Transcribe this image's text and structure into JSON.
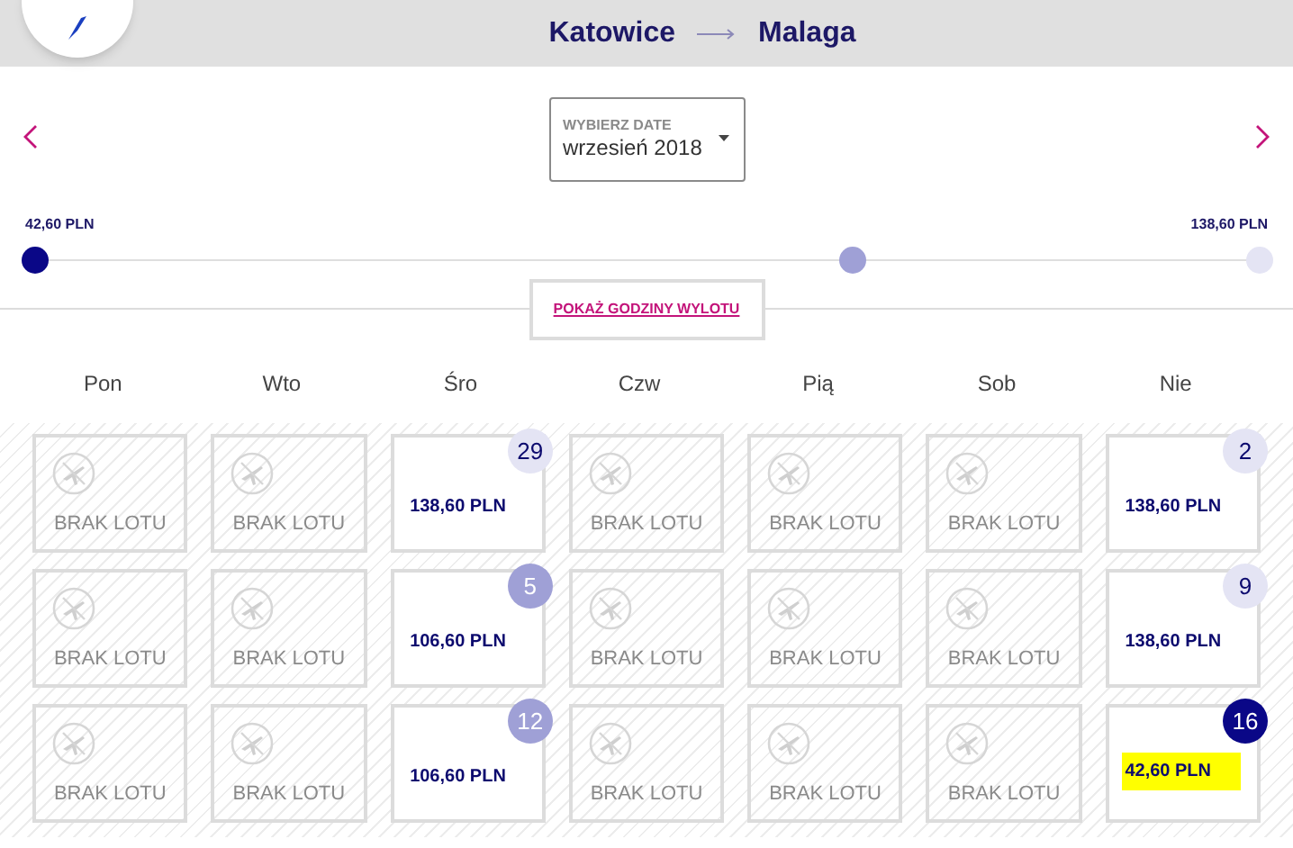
{
  "route": {
    "origin": "Katowice",
    "destination": "Malaga"
  },
  "date_picker": {
    "label": "WYBIERZ DATE",
    "value": "wrzesień 2018"
  },
  "price_scale": {
    "min_label": "42,60 PLN",
    "max_label": "138,60 PLN",
    "stops": [
      {
        "color": "#0a0787"
      },
      {
        "color": "#9fa0d6"
      },
      {
        "color": "#e4e4f4"
      }
    ]
  },
  "show_times_link": "POKAŻ GODZINY WYLOTU",
  "weekdays": [
    "Pon",
    "Wto",
    "Śro",
    "Czw",
    "Pią",
    "Sob",
    "Nie"
  ],
  "weeks": [
    [
      {
        "kind": "empty",
        "label": "BRAK LOTU"
      },
      {
        "kind": "empty",
        "label": "BRAK LOTU"
      },
      {
        "kind": "flight",
        "day": "29",
        "price": "138,60 PLN",
        "color": "#e4e4f4",
        "highlighted": false
      },
      {
        "kind": "empty",
        "label": "BRAK LOTU"
      },
      {
        "kind": "empty",
        "label": "BRAK LOTU"
      },
      {
        "kind": "empty",
        "label": "BRAK LOTU"
      },
      {
        "kind": "flight",
        "day": "2",
        "price": "138,60 PLN",
        "color": "#e4e4f4",
        "highlighted": false
      }
    ],
    [
      {
        "kind": "empty",
        "label": "BRAK LOTU"
      },
      {
        "kind": "empty",
        "label": "BRAK LOTU"
      },
      {
        "kind": "flight",
        "day": "5",
        "price": "106,60 PLN",
        "color": "#9fa0d6",
        "highlighted": false
      },
      {
        "kind": "empty",
        "label": "BRAK LOTU"
      },
      {
        "kind": "empty",
        "label": "BRAK LOTU"
      },
      {
        "kind": "empty",
        "label": "BRAK LOTU"
      },
      {
        "kind": "flight",
        "day": "9",
        "price": "138,60 PLN",
        "color": "#e4e4f4",
        "highlighted": false
      }
    ],
    [
      {
        "kind": "empty",
        "label": "BRAK LOTU"
      },
      {
        "kind": "empty",
        "label": "BRAK LOTU"
      },
      {
        "kind": "flight",
        "day": "12",
        "price": "106,60 PLN",
        "color": "#9fa0d6",
        "highlighted": false
      },
      {
        "kind": "empty",
        "label": "BRAK LOTU"
      },
      {
        "kind": "empty",
        "label": "BRAK LOTU"
      },
      {
        "kind": "empty",
        "label": "BRAK LOTU"
      },
      {
        "kind": "flight",
        "day": "16",
        "price": "42,60 PLN",
        "color": "#0a0787",
        "highlighted": true
      }
    ]
  ]
}
